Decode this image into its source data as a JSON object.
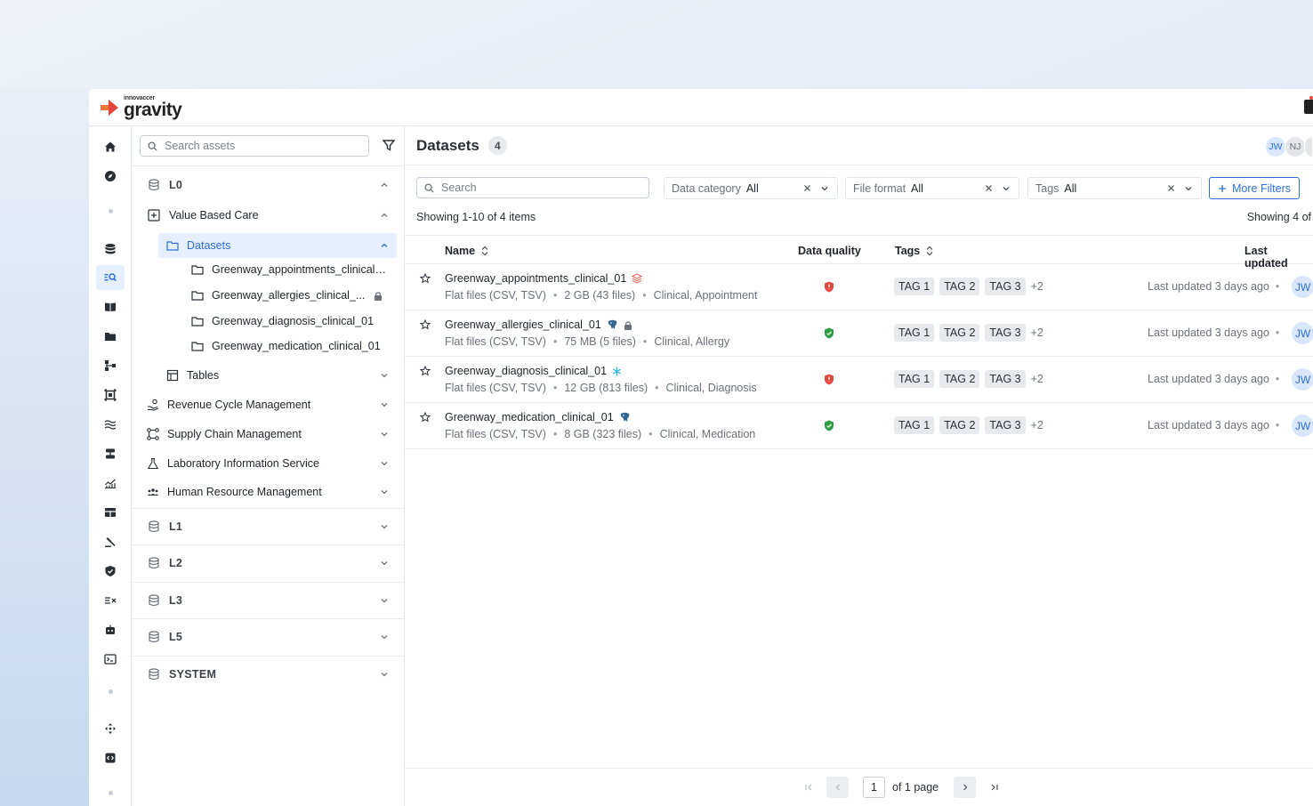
{
  "brand": {
    "small": "innovaccer",
    "name": "gravity",
    "accent": "#e5473c"
  },
  "tree": {
    "search_placeholder": "Search assets",
    "levels_top": {
      "label": "L0"
    },
    "value_based_care": "Value Based Care",
    "datasets_label": "Datasets",
    "dataset_items": [
      "Greenway_appointments_clinical_...",
      "Greenway_allergies_clinical_...",
      "Greenway_diagnosis_clinical_01",
      "Greenway_medication_clinical_01"
    ],
    "tables_label": "Tables",
    "domains": [
      "Revenue Cycle Management",
      "Supply Chain Management",
      "Laboratory Information Service",
      "Human Resource Management"
    ],
    "levels": [
      "L1",
      "L2",
      "L3",
      "L5",
      "SYSTEM"
    ]
  },
  "main": {
    "title": "Datasets",
    "count": "4",
    "avatars": [
      "JW",
      "NJ"
    ],
    "search_placeholder": "Search",
    "filters": [
      {
        "key": "Data category",
        "value": "All"
      },
      {
        "key": "File format",
        "value": "All"
      },
      {
        "key": "Tags",
        "value": "All"
      }
    ],
    "more_filters": "More Filters",
    "showing_left": "Showing 1-10 of 4 items",
    "showing_right": "Showing 4 of",
    "columns": {
      "name": "Name",
      "quality": "Data quality",
      "tags": "Tags",
      "updated": "Last updated"
    },
    "rows": [
      {
        "name": "Greenway_appointments_clinical_01",
        "format": "Flat files (CSV, TSV)",
        "size": "2 GB (43 files)",
        "categories": "Clinical, Appointment",
        "quality": "bad",
        "tags": [
          "TAG 1",
          "TAG 2",
          "TAG 3"
        ],
        "more": "+2",
        "updated": "Last updated 3 days ago",
        "owner": "JW",
        "badge": "layers-icon"
      },
      {
        "name": "Greenway_allergies_clinical_01",
        "format": "Flat files (CSV, TSV)",
        "size": "75 MB (5 files)",
        "categories": "Clinical, Allergy",
        "quality": "good",
        "tags": [
          "TAG 1",
          "TAG 2",
          "TAG 3"
        ],
        "more": "+2",
        "updated": "Last updated 3 days ago",
        "owner": "JW",
        "badge": "postgres-icon"
      },
      {
        "name": "Greenway_diagnosis_clinical_01",
        "format": "Flat files (CSV, TSV)",
        "size": "12 GB (813 files)",
        "categories": "Clinical, Diagnosis",
        "quality": "bad",
        "tags": [
          "TAG 1",
          "TAG 2",
          "TAG 3"
        ],
        "more": "+2",
        "updated": "Last updated 3 days ago",
        "owner": "JW",
        "badge": "snowflake-icon"
      },
      {
        "name": "Greenway_medication_clinical_01",
        "format": "Flat files (CSV, TSV)",
        "size": "8 GB (323 files)",
        "categories": "Clinical, Medication",
        "quality": "good",
        "tags": [
          "TAG 1",
          "TAG 2",
          "TAG 3"
        ],
        "more": "+2",
        "updated": "Last updated 3 days ago",
        "owner": "JW",
        "badge": "postgres-icon"
      }
    ],
    "pager": {
      "page": "1",
      "of_text": "of 1 page"
    }
  },
  "colors": {
    "primary": "#2b6ed9",
    "good": "#2ea043",
    "bad": "#e5473c"
  }
}
